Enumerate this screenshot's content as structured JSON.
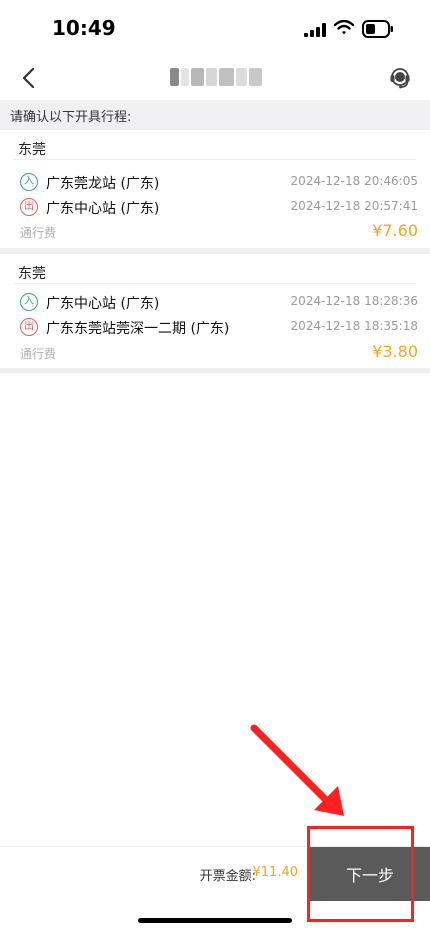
{
  "status": {
    "time": "10:49",
    "icons": [
      "signal-icon",
      "wifi-icon",
      "battery-icon"
    ]
  },
  "nav": {
    "back_icon": "chevron-left-icon",
    "support_icon": "headset-icon"
  },
  "prompt": "请确认以下开具行程:",
  "trips": [
    {
      "city": "东莞",
      "entry": {
        "badge": "入",
        "station": "广东莞龙站 (广东)",
        "time": "2024-12-18 20:46:05"
      },
      "exit": {
        "badge": "出",
        "station": "广东中心站 (广东)",
        "time": "2024-12-18 20:57:41"
      },
      "fee_label": "通行费",
      "fee": "¥7.60"
    },
    {
      "city": "东莞",
      "entry": {
        "badge": "入",
        "station": "广东中心站 (广东)",
        "time": "2024-12-18 18:28:36"
      },
      "exit": {
        "badge": "出",
        "station": "广东东莞站莞深一二期 (广东)",
        "time": "2024-12-18 18:35:18"
      },
      "fee_label": "通行费",
      "fee": "¥3.80"
    }
  ],
  "bottom": {
    "total_label": "开票金额:",
    "total_amount": "¥11.40",
    "next_label": "下一步"
  },
  "colors": {
    "accent": "#f5a623",
    "entry_badge": "#3aa37a",
    "exit_badge": "#e06060",
    "next_button": "#5a5a5a",
    "annotation": "#ff2020"
  }
}
